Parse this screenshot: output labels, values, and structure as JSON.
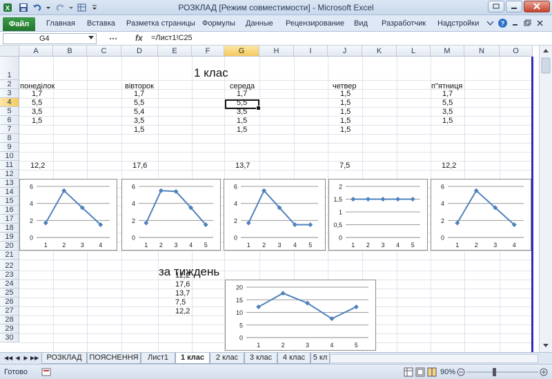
{
  "window": {
    "title": "РОЗКЛАД  [Режим совместимости]  -  Microsoft Excel"
  },
  "ribbon": {
    "file_tab": "Файл",
    "tabs": [
      "Главная",
      "Вставка",
      "Разметка страницы",
      "Формулы",
      "Данные",
      "Рецензирование",
      "Вид",
      "Разработчик",
      "Надстройки"
    ]
  },
  "formula_bar": {
    "name_box": "G4",
    "fx": "fx",
    "formula": "=Лист1!C25"
  },
  "columns": [
    "A",
    "B",
    "C",
    "D",
    "E",
    "F",
    "G",
    "H",
    "I",
    "J",
    "K",
    "L",
    "M",
    "N",
    "O"
  ],
  "rows": [
    "1",
    "2",
    "3",
    "4",
    "5",
    "6",
    "7",
    "8",
    "9",
    "10",
    "11",
    "12",
    "13",
    "14",
    "15",
    "16",
    "17",
    "18",
    "19",
    "20",
    "21",
    "22",
    "23",
    "24",
    "25",
    "26",
    "27",
    "28",
    "29",
    "30"
  ],
  "cells": {
    "title": "1 клас",
    "days": [
      "понеділок",
      "вівторок",
      "середа",
      "четвер",
      "п\"ятниця"
    ],
    "monday": [
      "1,7",
      "5,5",
      "3,5",
      "1,5"
    ],
    "tuesday": [
      "1,7",
      "5,5",
      "5,4",
      "3,5",
      "1,5"
    ],
    "wednesday": [
      "1,7",
      "5,5",
      "3,5",
      "1,5",
      "1,5"
    ],
    "thursday": [
      "1,5",
      "1,5",
      "1,5",
      "1,5",
      "1,5"
    ],
    "friday": [
      "1,7",
      "5,5",
      "3,5",
      "1,5"
    ],
    "totals": [
      "12,2",
      "17,6",
      "13,7",
      "7,5",
      "12,2"
    ],
    "week_title": "за тиждень",
    "week_values": [
      "12,2",
      "17,6",
      "13,7",
      "7,5",
      "12,2"
    ]
  },
  "chart_data": [
    {
      "type": "line",
      "x": [
        1,
        2,
        3,
        4
      ],
      "values": [
        1.7,
        5.5,
        3.5,
        1.5
      ],
      "ylim": [
        0,
        6
      ],
      "yticks": [
        0,
        2,
        4,
        6
      ],
      "ytick_labels": [
        "0",
        "2",
        "4",
        "6"
      ]
    },
    {
      "type": "line",
      "x": [
        1,
        2,
        3,
        4,
        5
      ],
      "values": [
        1.7,
        5.5,
        5.4,
        3.5,
        1.5
      ],
      "ylim": [
        0,
        6
      ],
      "yticks": [
        0,
        2,
        4,
        6
      ],
      "ytick_labels": [
        "0",
        "2",
        "4",
        "6"
      ]
    },
    {
      "type": "line",
      "x": [
        1,
        2,
        3,
        4,
        5
      ],
      "values": [
        1.7,
        5.5,
        3.5,
        1.5,
        1.5
      ],
      "ylim": [
        0,
        6
      ],
      "yticks": [
        0,
        2,
        4,
        6
      ],
      "ytick_labels": [
        "0",
        "2",
        "4",
        "6"
      ]
    },
    {
      "type": "line",
      "x": [
        1,
        2,
        3,
        4,
        5
      ],
      "values": [
        1.5,
        1.5,
        1.5,
        1.5,
        1.5
      ],
      "ylim": [
        0,
        2
      ],
      "yticks": [
        0,
        0.5,
        1,
        1.5,
        2
      ],
      "ytick_labels": [
        "0",
        "0,5",
        "1",
        "1,5",
        "2"
      ]
    },
    {
      "type": "line",
      "x": [
        1,
        2,
        3,
        4
      ],
      "values": [
        1.7,
        5.5,
        3.5,
        1.5
      ],
      "ylim": [
        0,
        6
      ],
      "yticks": [
        0,
        2,
        4,
        6
      ],
      "ytick_labels": [
        "0",
        "2",
        "4",
        "6"
      ]
    },
    {
      "type": "line",
      "x": [
        1,
        2,
        3,
        4,
        5
      ],
      "values": [
        12.2,
        17.6,
        13.7,
        7.5,
        12.2
      ],
      "ylim": [
        0,
        20
      ],
      "yticks": [
        0,
        5,
        10,
        15,
        20
      ],
      "ytick_labels": [
        "0",
        "5",
        "10",
        "15",
        "20"
      ]
    }
  ],
  "series_color": "#4f81bd",
  "sheet_tabs": [
    "РОЗКЛАД",
    "ПОЯСНЕННЯ",
    "Лист1",
    "1 клас",
    "2 клас",
    "3 клас",
    "4 клас",
    "5 кл"
  ],
  "active_tab": "1 клас",
  "status": {
    "ready": "Готово",
    "zoom": "90%"
  }
}
